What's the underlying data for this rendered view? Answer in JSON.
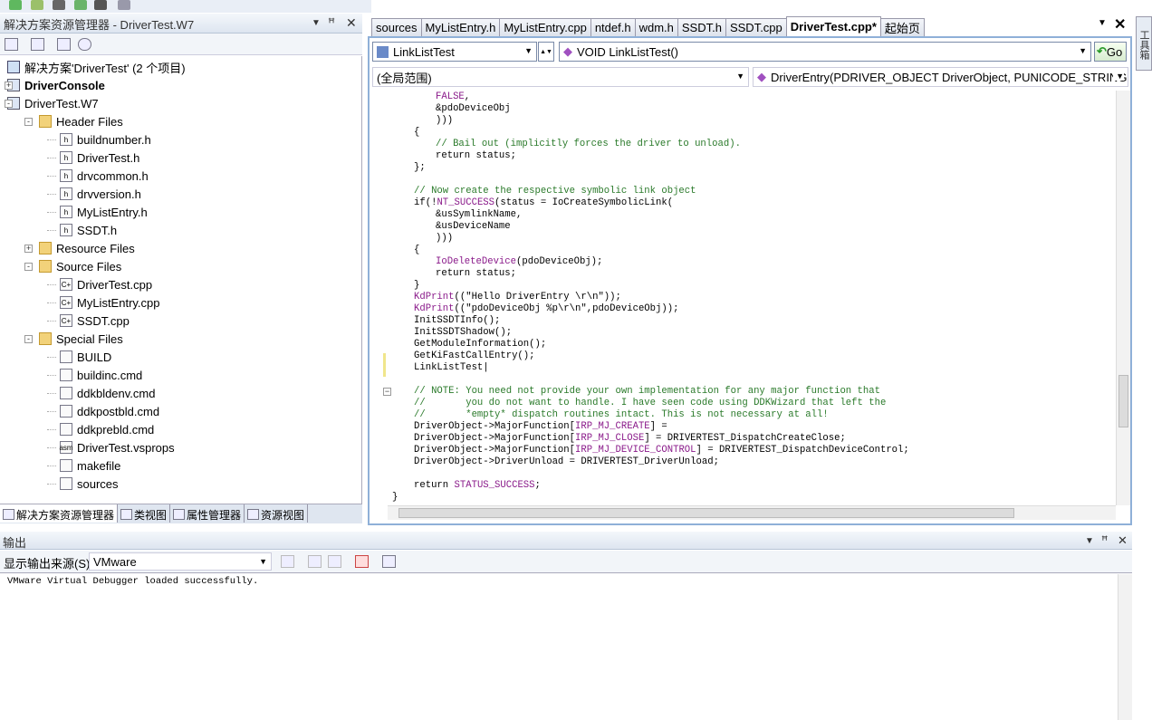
{
  "solution_explorer": {
    "title": "解决方案资源管理器 - DriverTest.W7",
    "tree": [
      {
        "label": "解决方案'DriverTest' (2 个项目)",
        "icon": "solution",
        "level": 0
      },
      {
        "label": "DriverConsole",
        "icon": "project",
        "level": 0,
        "bold": true,
        "expander": "+"
      },
      {
        "label": "DriverTest.W7",
        "icon": "project",
        "level": 0,
        "expander": "-"
      },
      {
        "label": "Header Files",
        "icon": "folder-open",
        "level": 1,
        "expander": "-"
      },
      {
        "label": "buildnumber.h",
        "icon": "h-file",
        "level": 2
      },
      {
        "label": "DriverTest.h",
        "icon": "h-file",
        "level": 2
      },
      {
        "label": "drvcommon.h",
        "icon": "h-file",
        "level": 2
      },
      {
        "label": "drvversion.h",
        "icon": "h-file",
        "level": 2
      },
      {
        "label": "MyListEntry.h",
        "icon": "h-file",
        "level": 2
      },
      {
        "label": "SSDT.h",
        "icon": "h-file",
        "level": 2
      },
      {
        "label": "Resource Files",
        "icon": "folder",
        "level": 1,
        "expander": "+"
      },
      {
        "label": "Source Files",
        "icon": "folder-open",
        "level": 1,
        "expander": "-"
      },
      {
        "label": "DriverTest.cpp",
        "icon": "cpp-file",
        "level": 2
      },
      {
        "label": "MyListEntry.cpp",
        "icon": "cpp-file",
        "level": 2
      },
      {
        "label": "SSDT.cpp",
        "icon": "cpp-file",
        "level": 2
      },
      {
        "label": "Special Files",
        "icon": "folder-open",
        "level": 1,
        "expander": "-"
      },
      {
        "label": "BUILD",
        "icon": "file",
        "level": 2
      },
      {
        "label": "buildinc.cmd",
        "icon": "cmd-file",
        "level": 2
      },
      {
        "label": "ddkbldenv.cmd",
        "icon": "cmd-file",
        "level": 2
      },
      {
        "label": "ddkpostbld.cmd",
        "icon": "cmd-file",
        "level": 2
      },
      {
        "label": "ddkprebld.cmd",
        "icon": "cmd-file",
        "level": 2
      },
      {
        "label": "DriverTest.vsprops",
        "icon": "asm-file",
        "level": 2
      },
      {
        "label": "makefile",
        "icon": "file",
        "level": 2
      },
      {
        "label": "sources",
        "icon": "file",
        "level": 2
      }
    ],
    "bottom_tabs": [
      "解决方案资源管理器",
      "类视图",
      "属性管理器",
      "资源视图"
    ]
  },
  "editor": {
    "tabs": [
      "sources",
      "MyListEntry.h",
      "MyListEntry.cpp",
      "ntdef.h",
      "wdm.h",
      "SSDT.h",
      "SSDT.cpp",
      "DriverTest.cpp*",
      "起始页"
    ],
    "active_tab": 7,
    "class_combo": "LinkListTest",
    "function_combo": "VOID LinkListTest()",
    "go_button": "Go",
    "scope_combo": "(全局范围)",
    "member_combo": "DriverEntry(PDRIVER_OBJECT DriverObject, PUNICODE_STRING R",
    "code_lines": [
      {
        "i": 2,
        "p": [
          [
            "m",
            "FALSE"
          ],
          [
            "n",
            ","
          ]
        ]
      },
      {
        "i": 2,
        "p": [
          [
            "n",
            "&pdoDeviceObj"
          ]
        ]
      },
      {
        "i": 2,
        "p": [
          [
            "n",
            ")))"
          ]
        ]
      },
      {
        "i": 1,
        "p": [
          [
            "n",
            "{"
          ]
        ]
      },
      {
        "i": 2,
        "p": [
          [
            "c",
            "// Bail out (implicitly forces the driver to unload)."
          ]
        ]
      },
      {
        "i": 2,
        "p": [
          [
            "n",
            "return status;"
          ]
        ]
      },
      {
        "i": 1,
        "p": [
          [
            "n",
            "};"
          ]
        ]
      },
      {
        "i": 0,
        "p": []
      },
      {
        "i": 1,
        "p": [
          [
            "c",
            "// Now create the respective symbolic link object"
          ]
        ]
      },
      {
        "i": 1,
        "p": [
          [
            "n",
            "if(!"
          ],
          [
            "m",
            "NT_SUCCESS"
          ],
          [
            "n",
            "(status = IoCreateSymbolicLink("
          ]
        ]
      },
      {
        "i": 2,
        "p": [
          [
            "n",
            "&usSymlinkName,"
          ]
        ]
      },
      {
        "i": 2,
        "p": [
          [
            "n",
            "&usDeviceName"
          ]
        ]
      },
      {
        "i": 2,
        "p": [
          [
            "n",
            ")))"
          ]
        ]
      },
      {
        "i": 1,
        "p": [
          [
            "n",
            "{"
          ]
        ]
      },
      {
        "i": 2,
        "p": [
          [
            "m",
            "IoDeleteDevice"
          ],
          [
            "n",
            "(pdoDeviceObj);"
          ]
        ]
      },
      {
        "i": 2,
        "p": [
          [
            "n",
            "return status;"
          ]
        ]
      },
      {
        "i": 1,
        "p": [
          [
            "n",
            "}"
          ]
        ]
      },
      {
        "i": 1,
        "p": [
          [
            "m",
            "KdPrint"
          ],
          [
            "n",
            "((\"Hello DriverEntry \\r\\n\"));"
          ]
        ]
      },
      {
        "i": 1,
        "p": [
          [
            "m",
            "KdPrint"
          ],
          [
            "n",
            "((\"pdoDeviceObj %p\\r\\n\",pdoDeviceObj));"
          ]
        ]
      },
      {
        "i": 1,
        "p": [
          [
            "n",
            "InitSSDTInfo();"
          ]
        ]
      },
      {
        "i": 1,
        "p": [
          [
            "n",
            "InitSSDTShadow();"
          ]
        ]
      },
      {
        "i": 1,
        "p": [
          [
            "n",
            "GetModuleInformation();"
          ]
        ]
      },
      {
        "i": 1,
        "p": [
          [
            "n",
            "GetKiFastCallEntry();"
          ]
        ]
      },
      {
        "i": 1,
        "p": [
          [
            "n",
            "LinkListTest|"
          ]
        ]
      },
      {
        "i": 0,
        "p": []
      },
      {
        "i": 1,
        "p": [
          [
            "c",
            "// NOTE: You need not provide your own implementation for any major function that"
          ]
        ]
      },
      {
        "i": 1,
        "p": [
          [
            "c",
            "//       you do not want to handle. I have seen code using DDKWizard that left the"
          ]
        ]
      },
      {
        "i": 1,
        "p": [
          [
            "c",
            "//       *empty* dispatch routines intact. This is not necessary at all!"
          ]
        ]
      },
      {
        "i": 1,
        "p": [
          [
            "n",
            "DriverObject->MajorFunction["
          ],
          [
            "m",
            "IRP_MJ_CREATE"
          ],
          [
            "n",
            "] ="
          ]
        ]
      },
      {
        "i": 1,
        "p": [
          [
            "n",
            "DriverObject->MajorFunction["
          ],
          [
            "m",
            "IRP_MJ_CLOSE"
          ],
          [
            "n",
            "] = DRIVERTEST_DispatchCreateClose;"
          ]
        ]
      },
      {
        "i": 1,
        "p": [
          [
            "n",
            "DriverObject->MajorFunction["
          ],
          [
            "m",
            "IRP_MJ_DEVICE_CONTROL"
          ],
          [
            "n",
            "] = DRIVERTEST_DispatchDeviceControl;"
          ]
        ]
      },
      {
        "i": 1,
        "p": [
          [
            "n",
            "DriverObject->DriverUnload = DRIVERTEST_DriverUnload;"
          ]
        ]
      },
      {
        "i": 0,
        "p": []
      },
      {
        "i": 1,
        "p": [
          [
            "n",
            "return "
          ],
          [
            "m",
            "STATUS_SUCCESS"
          ],
          [
            "n",
            ";"
          ]
        ]
      },
      {
        "i": 0,
        "p": [
          [
            "n",
            "}"
          ]
        ]
      }
    ]
  },
  "output": {
    "title": "输出",
    "source_label": "显示输出来源(S):",
    "source_value": "VMware",
    "text": "VMware Virtual Debugger loaded successfully."
  },
  "toolbox": {
    "label": "工具箱"
  },
  "colors": {
    "comment": "#2a7a2a",
    "macro": "#8a1a8a",
    "frame": "#8fb0d8"
  }
}
